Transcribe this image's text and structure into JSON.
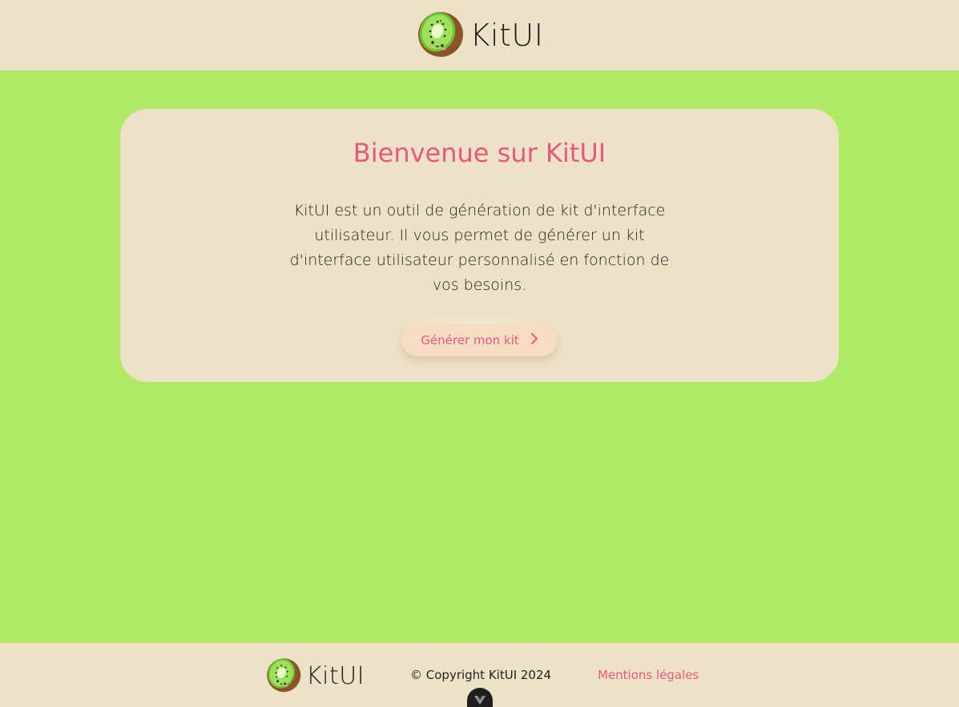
{
  "header": {
    "brand_name": "KitUI",
    "logo_icon": "kiwi-logo-icon"
  },
  "main": {
    "title": "Bienvenue sur KitUI",
    "description": "KitUI est un outil de génération de kit d'interface utilisateur. Il vous permet de générer un kit d'interface utilisateur personnalisé en fonction de vos besoins.",
    "cta_label": "Générer mon kit",
    "cta_icon": "chevron-right-icon"
  },
  "footer": {
    "brand_name": "KitUI",
    "copyright": "© Copyright KitUI 2024",
    "legal_link": "Mentions légales",
    "devtools_icon": "vue-devtools-icon"
  },
  "colors": {
    "page_background": "#b0e964",
    "surface": "#ede1c8",
    "accent": "#e9587a",
    "text": "#24211d"
  }
}
